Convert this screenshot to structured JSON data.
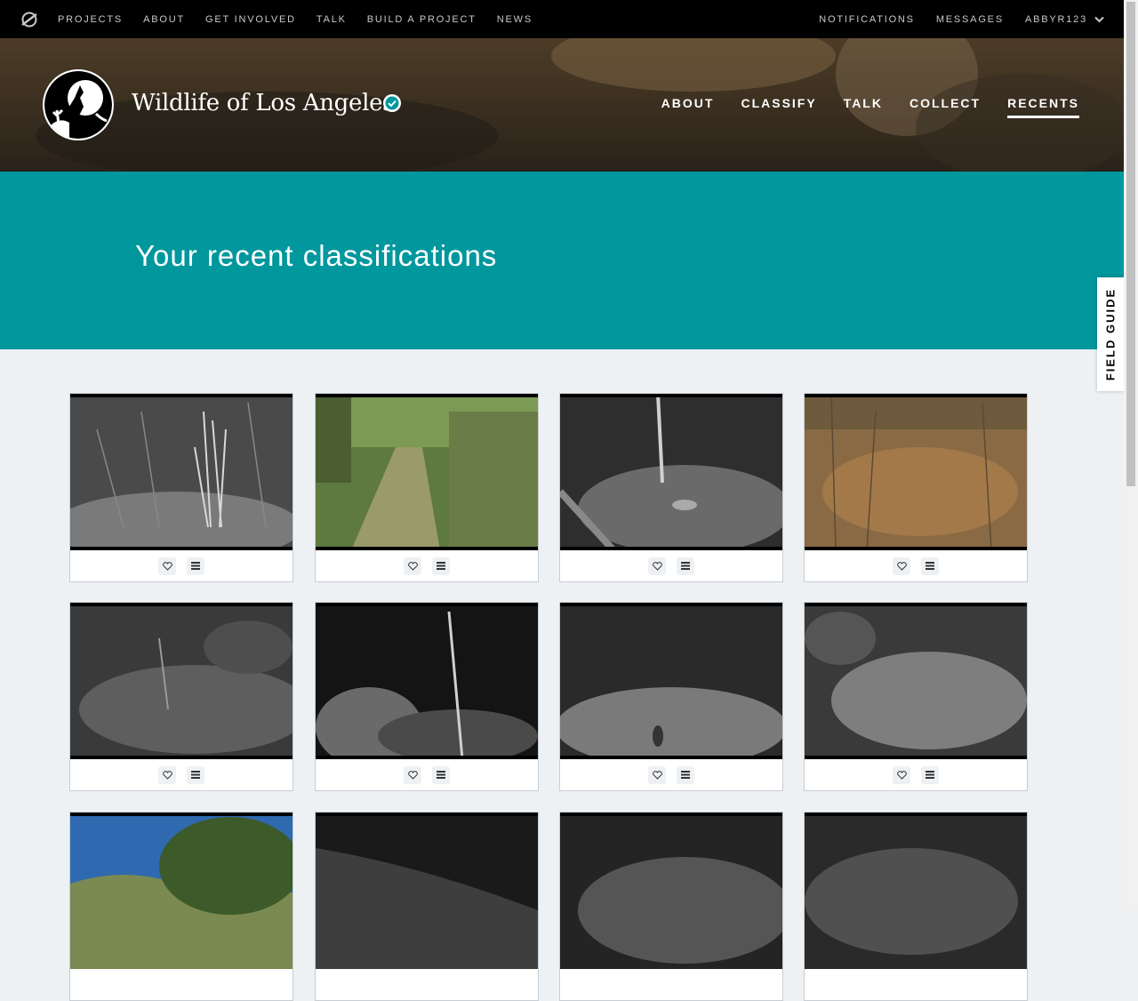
{
  "global_nav": {
    "links": [
      "PROJECTS",
      "ABOUT",
      "GET INVOLVED",
      "TALK",
      "BUILD A PROJECT",
      "NEWS"
    ],
    "right": {
      "notifications": "NOTIFICATIONS",
      "messages": "MESSAGES",
      "user": "ABBYR123"
    }
  },
  "project": {
    "title": "Wildlife of Los Angeles",
    "nav": [
      "ABOUT",
      "CLASSIFY",
      "TALK",
      "COLLECT",
      "RECENTS"
    ],
    "active_nav": "RECENTS"
  },
  "page": {
    "heading": "Your recent classifications"
  },
  "field_guide": {
    "label": "FIELD GUIDE"
  },
  "colors": {
    "teal": "#00979d",
    "background": "#eef1f4"
  },
  "icons": {
    "favorite": "heart-icon",
    "collect": "list-icon",
    "verified": "check-badge-icon"
  }
}
